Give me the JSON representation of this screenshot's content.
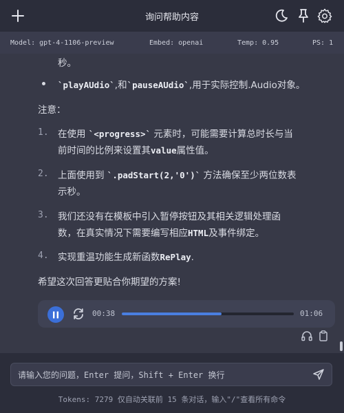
{
  "header": {
    "title": "询问帮助内容",
    "icons": [
      "plus-icon",
      "moon-icon",
      "pin-icon",
      "gear-icon"
    ]
  },
  "info_bar": {
    "model": "Model: gpt-4-1106-preview",
    "embed": "Embed: openai",
    "temp": "Temp: 0.95",
    "ps": "PS: 1"
  },
  "message": {
    "line_top": "秒。",
    "bullet": {
      "code1": "`playAUdio`",
      "mid": ",和",
      "code2": "`pauseAUdio`",
      "tail": ",用于实际控制.Audio对象。"
    },
    "note": "注意：",
    "items": [
      {
        "num": "1.",
        "line1_pre": "在使用 ",
        "line1_code": "`<progress>`",
        "line1_post": " 元素时，可能需要计算总时长与当",
        "line2_pre": "前时间的比例来设置其",
        "line2_code": "value",
        "line2_post": "属性值。"
      },
      {
        "num": "2.",
        "line1_pre": "上面使用到 ",
        "line1_code": "`.padStart(2,'0')`",
        "line1_post": " 方法确保至少两位数表",
        "line2": "示秒。"
      },
      {
        "num": "3.",
        "line1": "我们还没有在模板中引入暂停按钮及其相关逻辑处理函",
        "line2_pre": "数，在真实情况下需要编写相应",
        "line2_code": "HTML",
        "line2_post": "及事件绑定。"
      },
      {
        "num": "4.",
        "line1_pre": "实现重温功能生成新函数",
        "line1_code": "RePlay",
        "line1_post": "."
      }
    ],
    "closing": "希望这次回答更贴合你期望的方案!"
  },
  "player": {
    "current_time": "00:38",
    "total_time": "01:06",
    "progress": 0.58
  },
  "input": {
    "placeholder": "请输入您的问题，Enter 提问，Shift + Enter 换行"
  },
  "footer": {
    "hint": "Tokens: 7279 仅自动关联前 15 条对话，输入\"/\"查看所有命令"
  },
  "colors": {
    "accent": "#3b6fd8",
    "progress": "#4a7fe0",
    "message_bg": "#373947",
    "header_bg": "#2b2d3a"
  }
}
